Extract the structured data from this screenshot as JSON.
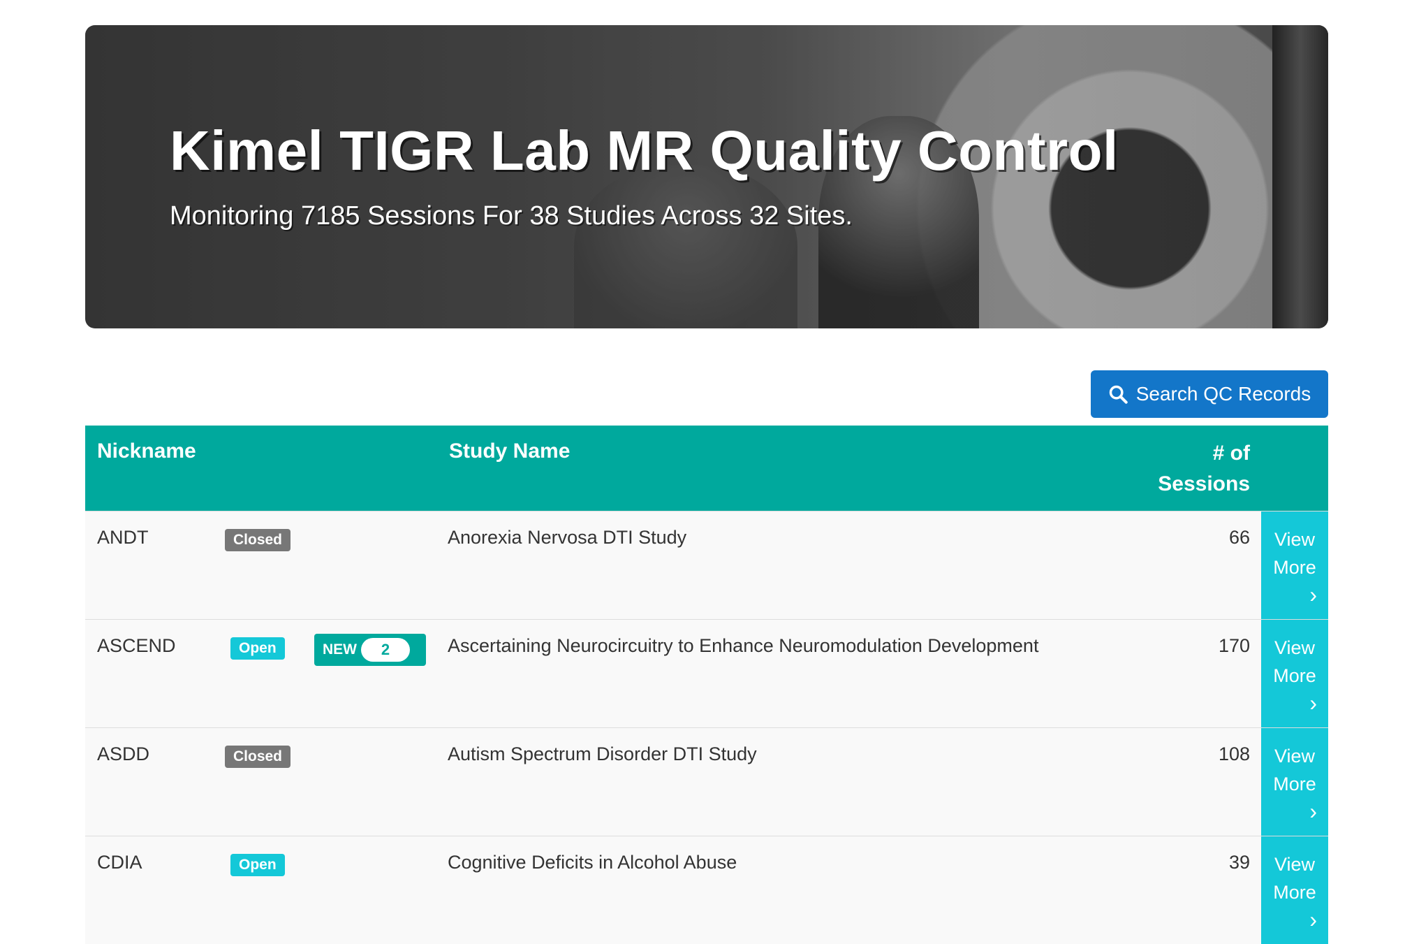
{
  "hero": {
    "title": "Kimel TIGR Lab MR Quality Control",
    "subtitle": "Monitoring 7185 Sessions For 38 Studies Across 32 Sites."
  },
  "search_button": {
    "label": "Search QC Records",
    "icon": "search-icon"
  },
  "table": {
    "headers": {
      "nickname": "Nickname",
      "study_name": "Study Name",
      "sessions_line1": "# of",
      "sessions_line2": "Sessions"
    },
    "rows": [
      {
        "nickname": "ANDT",
        "status": "Closed",
        "study": "Anorexia Nervosa DTI Study",
        "sessions": "66",
        "new_label": "",
        "new_count": ""
      },
      {
        "nickname": "ASCEND",
        "status": "Open",
        "study": "Ascertaining Neurocircuitry to Enhance Neuromodulation Development",
        "sessions": "170",
        "new_label": "NEW",
        "new_count": "2"
      },
      {
        "nickname": "ASDD",
        "status": "Closed",
        "study": "Autism Spectrum Disorder DTI Study",
        "sessions": "108",
        "new_label": "",
        "new_count": ""
      },
      {
        "nickname": "CDIA",
        "status": "Open",
        "study": "Cognitive Deficits in Alcohol Abuse",
        "sessions": "39",
        "new_label": "",
        "new_count": ""
      }
    ],
    "view_more_line1": "View",
    "view_more_line2": "More"
  },
  "colors": {
    "header_teal": "#00a99d",
    "open_badge": "#14c8d8",
    "closed_badge": "#777777",
    "search_blue": "#1376c9"
  }
}
